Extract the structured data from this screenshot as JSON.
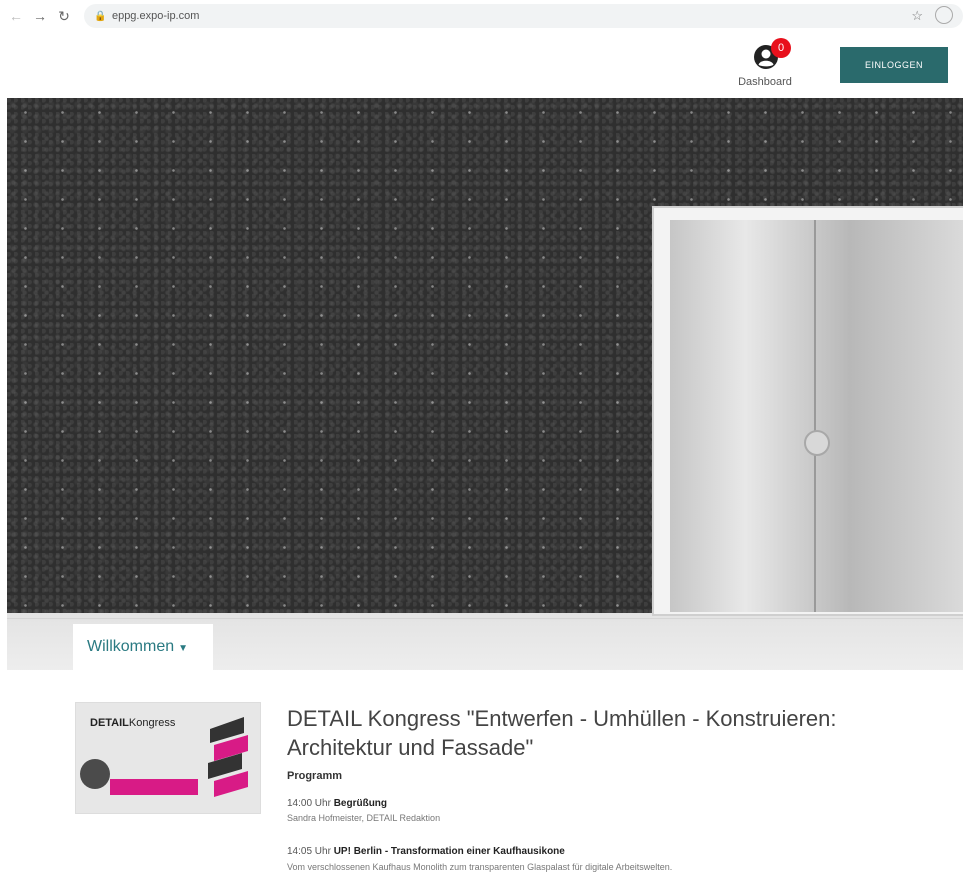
{
  "browser": {
    "url": "eppg.expo-ip.com"
  },
  "header": {
    "dashboard_label": "Dashboard",
    "badge_count": "0",
    "login_label": "EINLOGGEN"
  },
  "hero": {
    "tab_label": "Willkommen"
  },
  "event": {
    "thumb_logo_bold": "DETAIL",
    "thumb_logo_light": "Kongress",
    "title": "DETAIL Kongress \"Entwerfen - Umhüllen - Konstruieren: Architektur und Fassade\"",
    "section": "Programm",
    "program": [
      {
        "time": "14:00 Uhr",
        "title": "Begrüßung",
        "detail": "Sandra Hofmeister, DETAIL Redaktion"
      },
      {
        "time": "14:05 Uhr",
        "title": "UP! Berlin - Transformation einer Kaufhausikone",
        "detail": "Vom verschlossenen Kaufhaus Monolith zum transparenten Glaspalast für digitale Arbeitswelten."
      }
    ]
  },
  "colors": {
    "accent": "#2a6a6c",
    "badge": "#e8101c",
    "link": "#2a7a82"
  }
}
